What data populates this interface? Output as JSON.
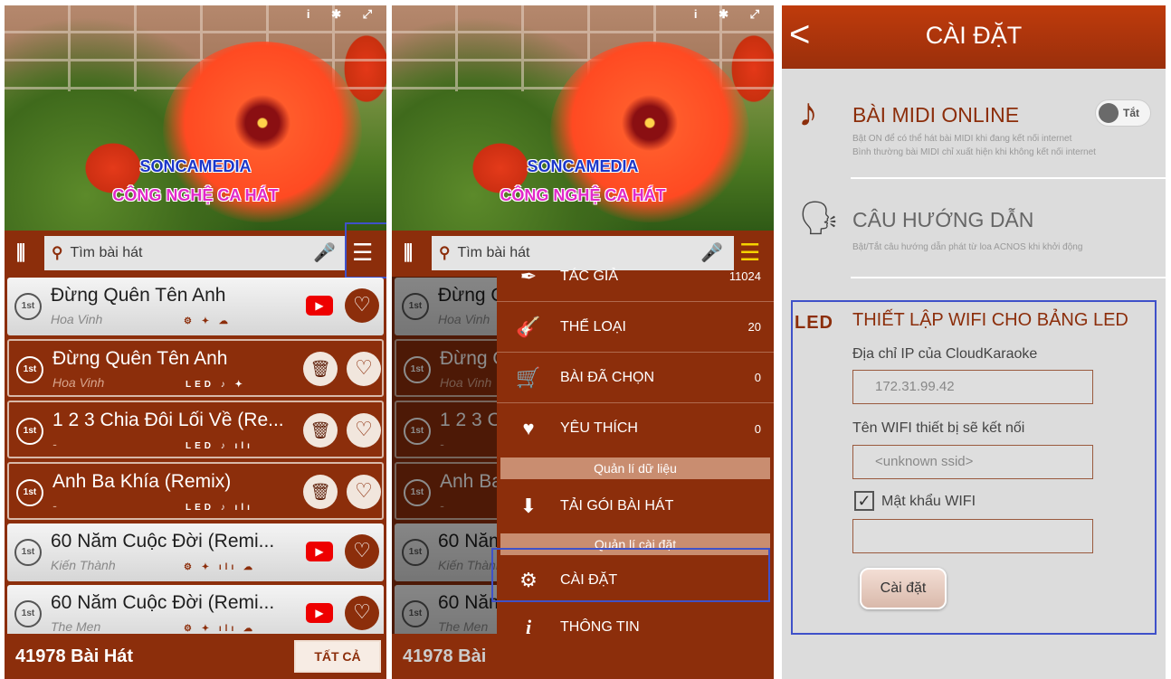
{
  "hero": {
    "line1": "SONCAMEDIA",
    "line2": "CÔNG NGHỆ CA HÁT"
  },
  "search": {
    "placeholder": "Tìm bài hát"
  },
  "songs": [
    {
      "title": "Đừng Quên Tên Anh",
      "artist": "Hoa Vinh",
      "tags": "⚙ ✦ ☁",
      "style": "light",
      "action": "youtube"
    },
    {
      "title": "Đừng Quên Tên Anh",
      "artist": "Hoa Vinh",
      "tags": "LED ♪ ✦",
      "style": "dark",
      "action": "trash"
    },
    {
      "title": "1 2 3 Chia Đôi Lối Về (Re...",
      "artist": "-",
      "tags": "LED ♪ ılı",
      "style": "dark",
      "action": "trash"
    },
    {
      "title": "Anh Ba Khía (Remix)",
      "artist": "-",
      "tags": "LED ♪ ılı",
      "style": "dark",
      "action": "trash"
    },
    {
      "title": "60 Năm Cuộc Đời (Remi...",
      "artist": "Kiến Thành",
      "tags": "⚙ ✦ ılı ☁",
      "style": "light",
      "action": "youtube"
    },
    {
      "title": "60 Năm Cuộc Đời (Remi...",
      "artist": "The Men",
      "tags": "⚙ ✦ ılı ☁",
      "style": "light",
      "action": "youtube"
    }
  ],
  "footer": {
    "count": "41978 Bài Hát",
    "count_short": "41978 Bài",
    "all_button": "TẤT CẢ"
  },
  "drawer": {
    "items": [
      {
        "label": "TÁC GIẢ",
        "count": "11024",
        "icon": "pen-icon"
      },
      {
        "label": "THỂ LOẠI",
        "count": "20",
        "icon": "guitar-icon"
      },
      {
        "label": "BÀI ĐÃ CHỌN",
        "count": "0",
        "icon": "cart-icon"
      },
      {
        "label": "YÊU THÍCH",
        "count": "0",
        "icon": "heart-icon"
      }
    ],
    "section_data": "Quản lí dữ liệu",
    "download": "TẢI GÓI BÀI HÁT",
    "section_settings": "Quản lí cài đặt",
    "settings": "CÀI ĐẶT",
    "info": "THÔNG TIN"
  },
  "settings_page": {
    "title": "CÀI ĐẶT",
    "midi": {
      "title": "BÀI MIDI ONLINE",
      "desc1": "Bật ON để có thể hát bài MIDI khi đang kết nối internet",
      "desc2": "Bình thường bài MIDI chỉ xuất hiện khi không kết nối internet",
      "toggle": "Tắt"
    },
    "guide": {
      "title": "CÂU HƯỚNG DẪN",
      "desc": "Bật/Tắt câu hướng dẫn phát từ loa ACNOS khi khởi động"
    },
    "led": {
      "icon_text": "LED",
      "title": "THIẾT LẬP WIFI CHO BẢNG LED",
      "ip_label": "Địa chỉ IP của CloudKaraoke",
      "ip_value": "172.31.99.42",
      "wifi_label": "Tên WIFI thiết bị sẽ kết nối",
      "wifi_value": "<unknown ssid>",
      "pass_label": "Mật khẩu WIFI",
      "pass_value": "",
      "button": "Cài đặt"
    }
  }
}
